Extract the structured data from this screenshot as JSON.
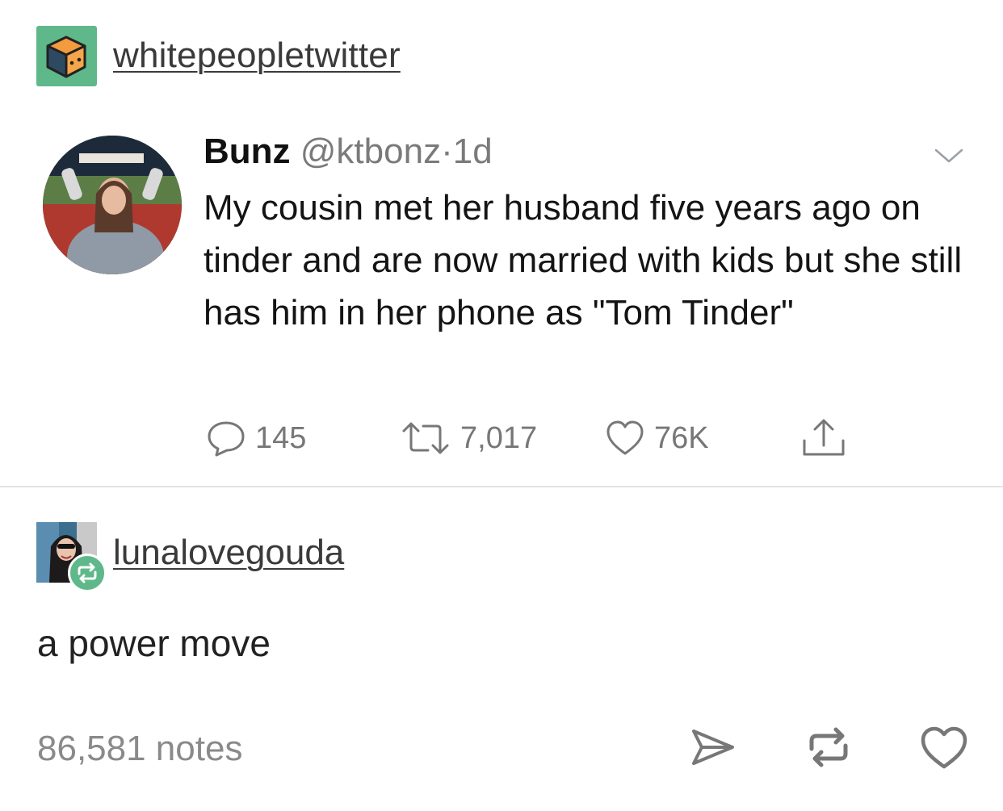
{
  "post": {
    "blog_name": "whitepeopletwitter",
    "blog_avatar_icon": "cube-icon"
  },
  "tweet": {
    "author": "Bunz",
    "handle": "@ktbonz",
    "dot": "·",
    "time": "1d",
    "text": "My cousin met her husband five years ago on tinder and are now married with kids but she still has him in her phone as \"Tom Tinder\"",
    "replies": "145",
    "retweets": "7,017",
    "likes": "76K"
  },
  "reblog": {
    "username": "lunalovegouda",
    "text": "a power move"
  },
  "footer": {
    "notes": "86,581 notes"
  },
  "colors": {
    "accent_green": "#5fb88a",
    "text_dark": "#222222",
    "text_muted": "#7a7a7a"
  }
}
